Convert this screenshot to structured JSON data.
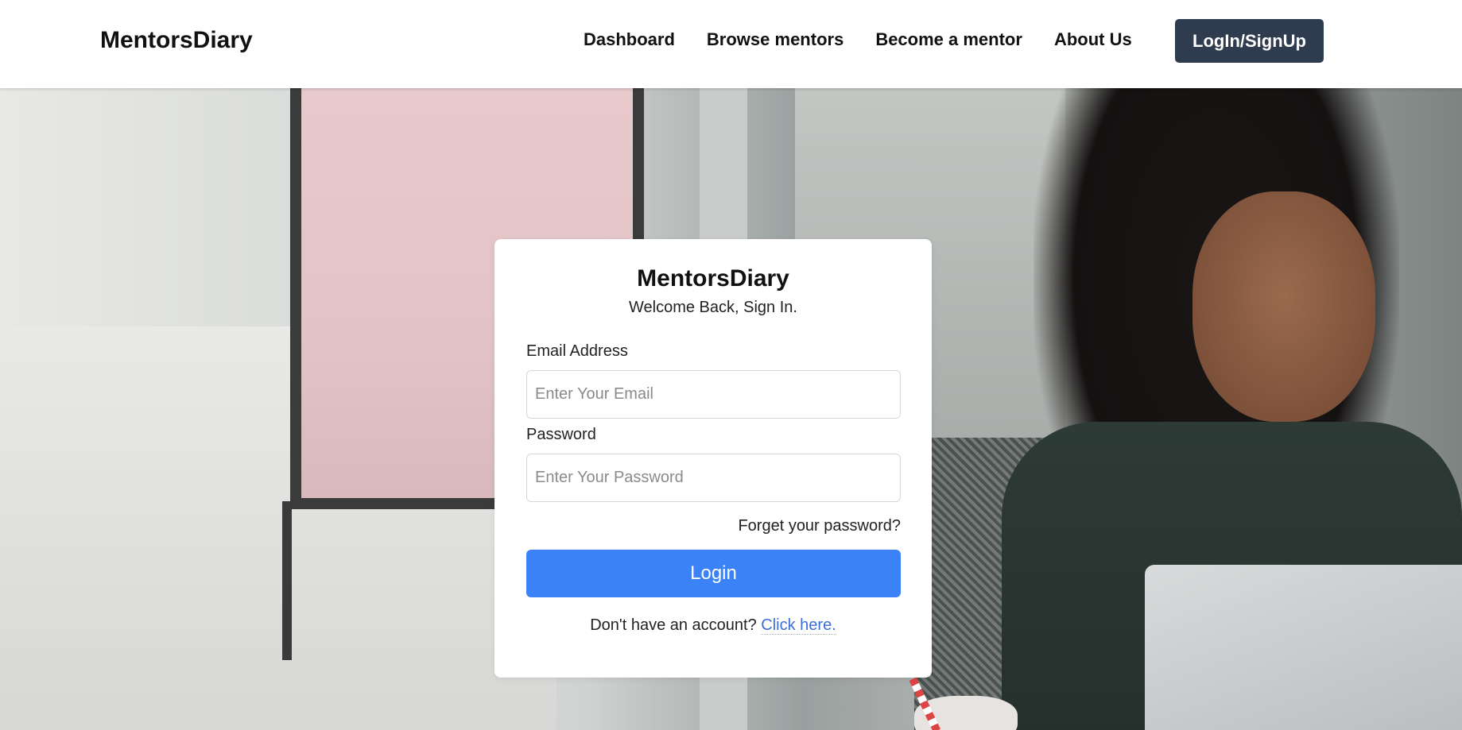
{
  "nav": {
    "brand": "MentorsDiary",
    "links": [
      "Dashboard",
      "Browse mentors",
      "Become a mentor",
      "About Us"
    ],
    "cta": "LogIn/SignUp",
    "cta_color": "#2f3b4e"
  },
  "login": {
    "title": "MentorsDiary",
    "subtitle": "Welcome Back, Sign In.",
    "email_label": "Email Address",
    "email_placeholder": "Enter Your Email",
    "password_label": "Password",
    "password_placeholder": "Enter Your Password",
    "forgot": "Forget your password?",
    "submit": "Login",
    "submit_color": "#3b82f6",
    "signup_prompt": "Don't have an account?",
    "signup_link": "Click here."
  }
}
